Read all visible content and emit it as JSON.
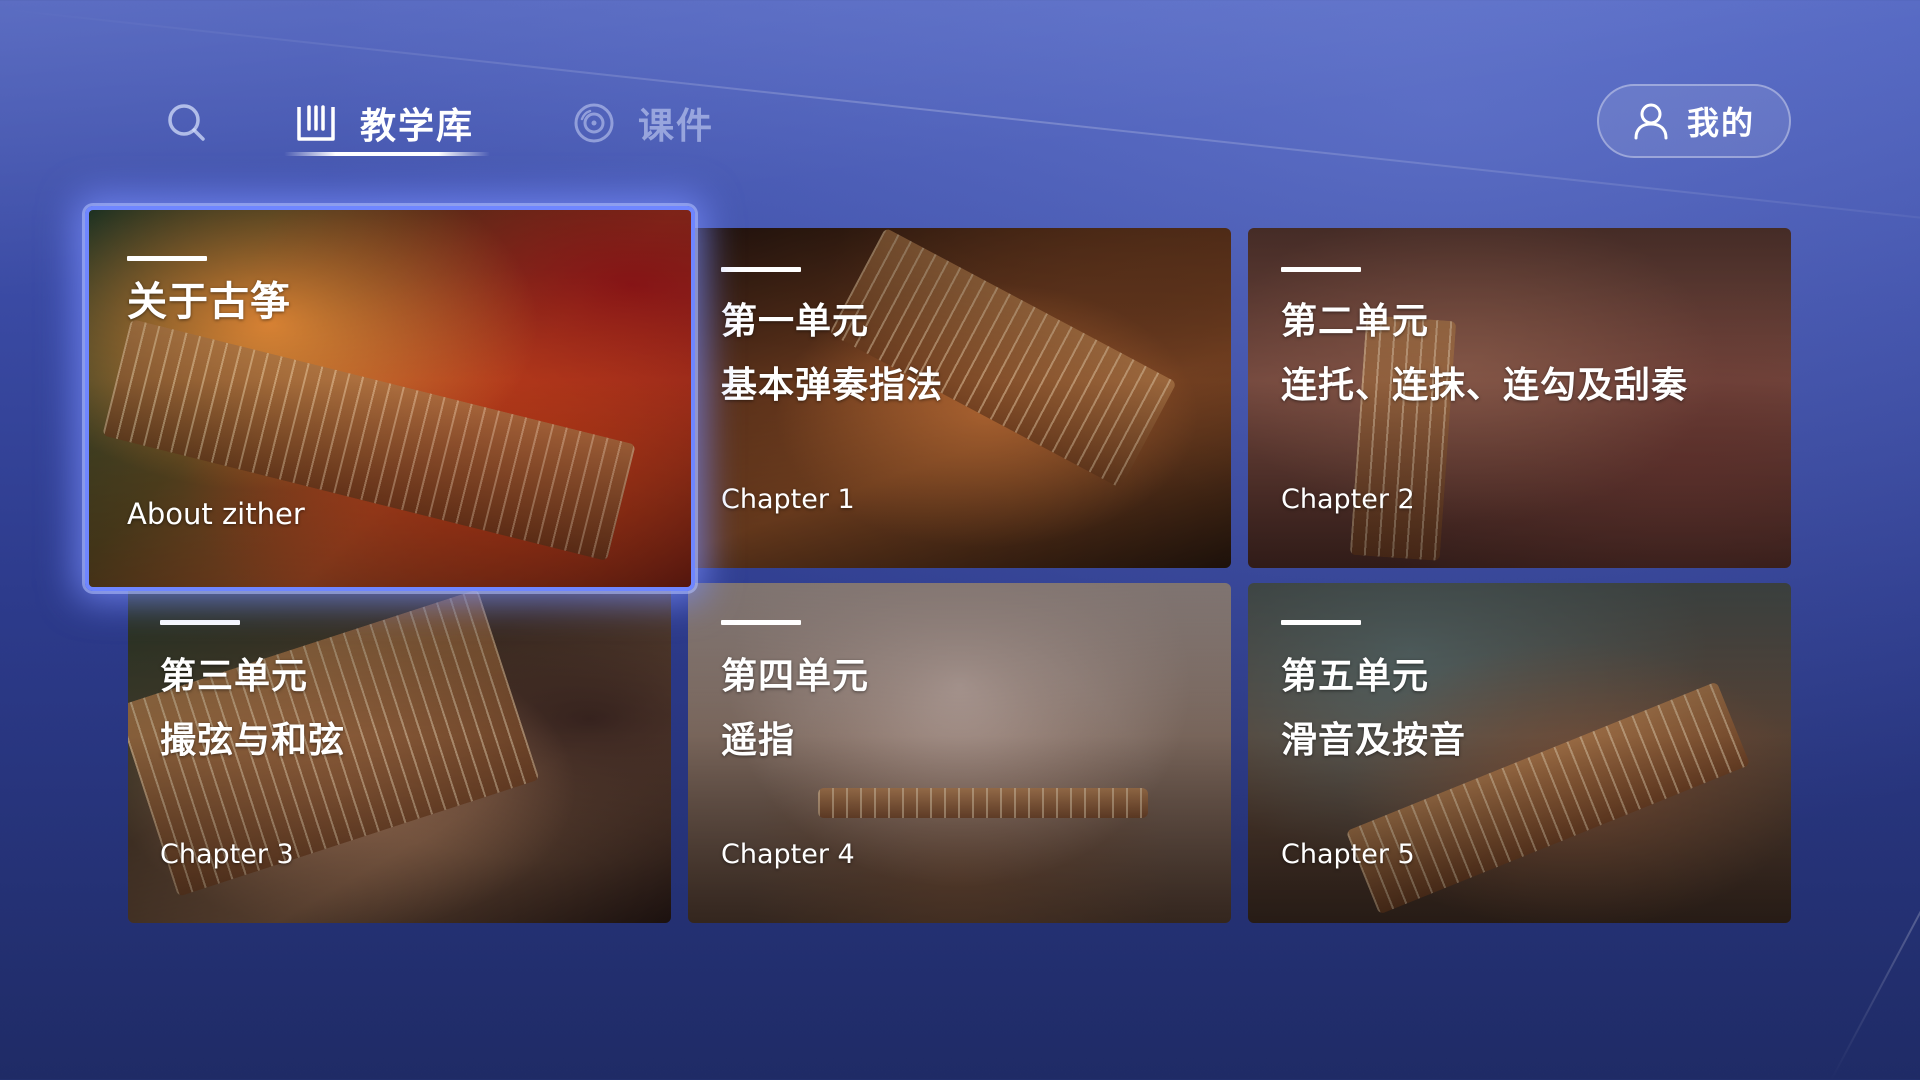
{
  "nav": {
    "search_icon": "search-icon",
    "tabs": [
      {
        "label": "教学库",
        "icon": "library-book-icon",
        "active": true
      },
      {
        "label": "课件",
        "icon": "disc-icon",
        "active": false
      }
    ],
    "mine": {
      "label": "我的",
      "icon": "user-icon"
    }
  },
  "colors": {
    "background_top": "#4e61bd",
    "background_bottom": "#1f2b66",
    "focus_border": "#6f86ff"
  },
  "cards": [
    {
      "title_lines": [
        "关于古筝"
      ],
      "subtitle": "About zither",
      "focused": true
    },
    {
      "title_lines": [
        "第一单元",
        "基本弹奏指法"
      ],
      "subtitle": "Chapter 1",
      "focused": false
    },
    {
      "title_lines": [
        "第二单元",
        "连托、连抹、连勾及刮奏"
      ],
      "subtitle": "Chapter 2",
      "focused": false
    },
    {
      "title_lines": [
        "第三单元",
        "撮弦与和弦"
      ],
      "subtitle": "Chapter 3",
      "focused": false
    },
    {
      "title_lines": [
        "第四单元",
        "遥指"
      ],
      "subtitle": "Chapter 4",
      "focused": false
    },
    {
      "title_lines": [
        "第五单元",
        "滑音及按音"
      ],
      "subtitle": "Chapter 5",
      "focused": false
    }
  ]
}
